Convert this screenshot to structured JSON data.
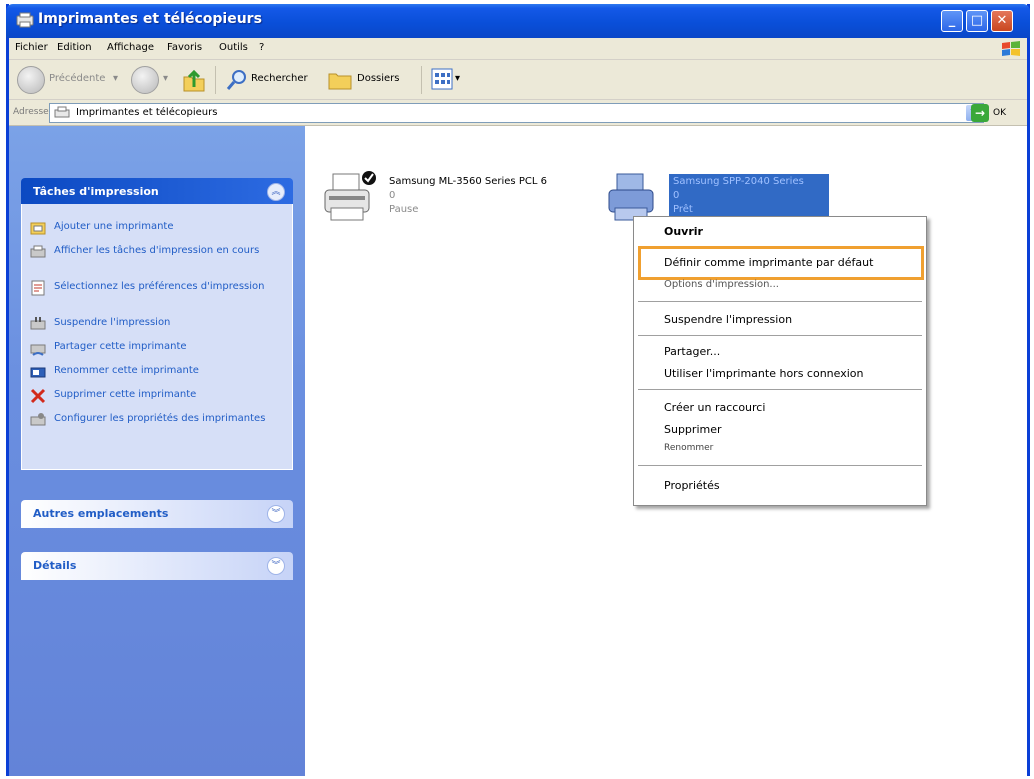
{
  "window": {
    "title": "Imprimantes et télécopieurs"
  },
  "menubar": {
    "items": [
      "Fichier",
      "Edition",
      "Affichage",
      "Favoris",
      "Outils",
      "?"
    ]
  },
  "toolbar": {
    "back": "Précédente",
    "search": "Rechercher",
    "folders": "Dossiers"
  },
  "address": {
    "label": "Adresse",
    "value": "Imprimantes et télécopieurs",
    "go": "OK"
  },
  "taskpane": {
    "printing": {
      "title": "Tâches d'impression",
      "tasks": [
        "Ajouter une imprimante",
        "Afficher les tâches d'impression en cours",
        "Sélectionnez les préférences d'impression",
        "Suspendre l'impression",
        "Partager cette imprimante",
        "Renommer cette imprimante",
        "Supprimer cette imprimante",
        "Configurer les propriétés des imprimantes"
      ]
    },
    "other_places": {
      "title": "Autres emplacements"
    },
    "details": {
      "title": "Détails"
    }
  },
  "printers": [
    {
      "name": "Samsung ML-3560 Series PCL 6",
      "count": "0",
      "status": "Pause",
      "is_default": true
    },
    {
      "name": "Samsung SPP-2040 Series",
      "count": "0",
      "status": "Prêt",
      "selected": true
    }
  ],
  "context_menu": {
    "open": "Ouvrir",
    "set_default": "Définir comme imprimante par défaut",
    "print_options": "Options d'impression...",
    "pause": "Suspendre l'impression",
    "share": "Partager...",
    "offline": "Utiliser l'imprimante hors connexion",
    "shortcut": "Créer un raccourci",
    "delete": "Supprimer",
    "rename": "Renommer",
    "properties": "Propriétés"
  },
  "colors": {
    "titlebar": "#0a4fd9",
    "taskpane": "#6a8fe0",
    "link": "#215dc6",
    "highlight_box": "#f0a030",
    "selection": "#316ac5"
  }
}
